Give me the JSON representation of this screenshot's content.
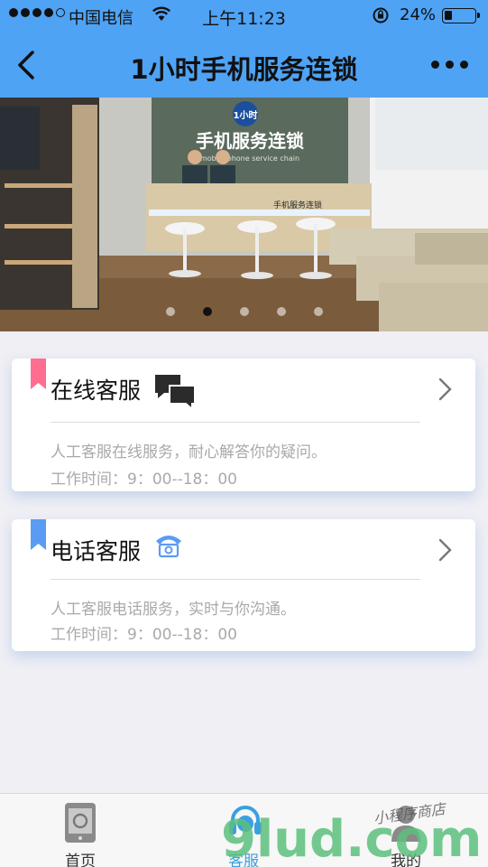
{
  "status_bar": {
    "carrier": "中国电信",
    "time": "上午11:23",
    "battery_percent": "24%",
    "battery_level": 0.24
  },
  "nav": {
    "title": "1小时手机服务连锁",
    "back_icon": "chevron-left-icon",
    "more_icon": "more-dots-icon"
  },
  "banner": {
    "sign_text": "手机服务连锁",
    "sign_sub": "mobile phone service chain",
    "desk_text": "手机服务连锁",
    "logo_text": "1小时",
    "page_count": 5,
    "active_page": 1
  },
  "services": [
    {
      "title": "在线客服",
      "icon": "chat-bubbles-icon",
      "bookmark_color": "#ff6e8e",
      "desc": "人工客服在线服务，耐心解答你的疑问。",
      "hours": "工作时间：9：00--18：00"
    },
    {
      "title": "电话客服",
      "icon": "telephone-icon",
      "bookmark_color": "#5a9cf3",
      "desc": "人工客服电话服务，实时与你沟通。",
      "hours": "工作时间：9：00--18：00"
    }
  ],
  "tabs": [
    {
      "label": "首页",
      "icon": "phone-home-icon",
      "active": false
    },
    {
      "label": "客服",
      "icon": "headset-icon",
      "active": true
    },
    {
      "label": "我的",
      "icon": "user-icon",
      "active": false
    }
  ],
  "watermark": {
    "text": "9lud.com",
    "script_text": "小程序商店"
  },
  "colors": {
    "nav_bg": "#4fa3f5",
    "page_bg": "#efeff4",
    "muted_text": "#a9a9a9",
    "active_tab": "#3aa0e0"
  }
}
